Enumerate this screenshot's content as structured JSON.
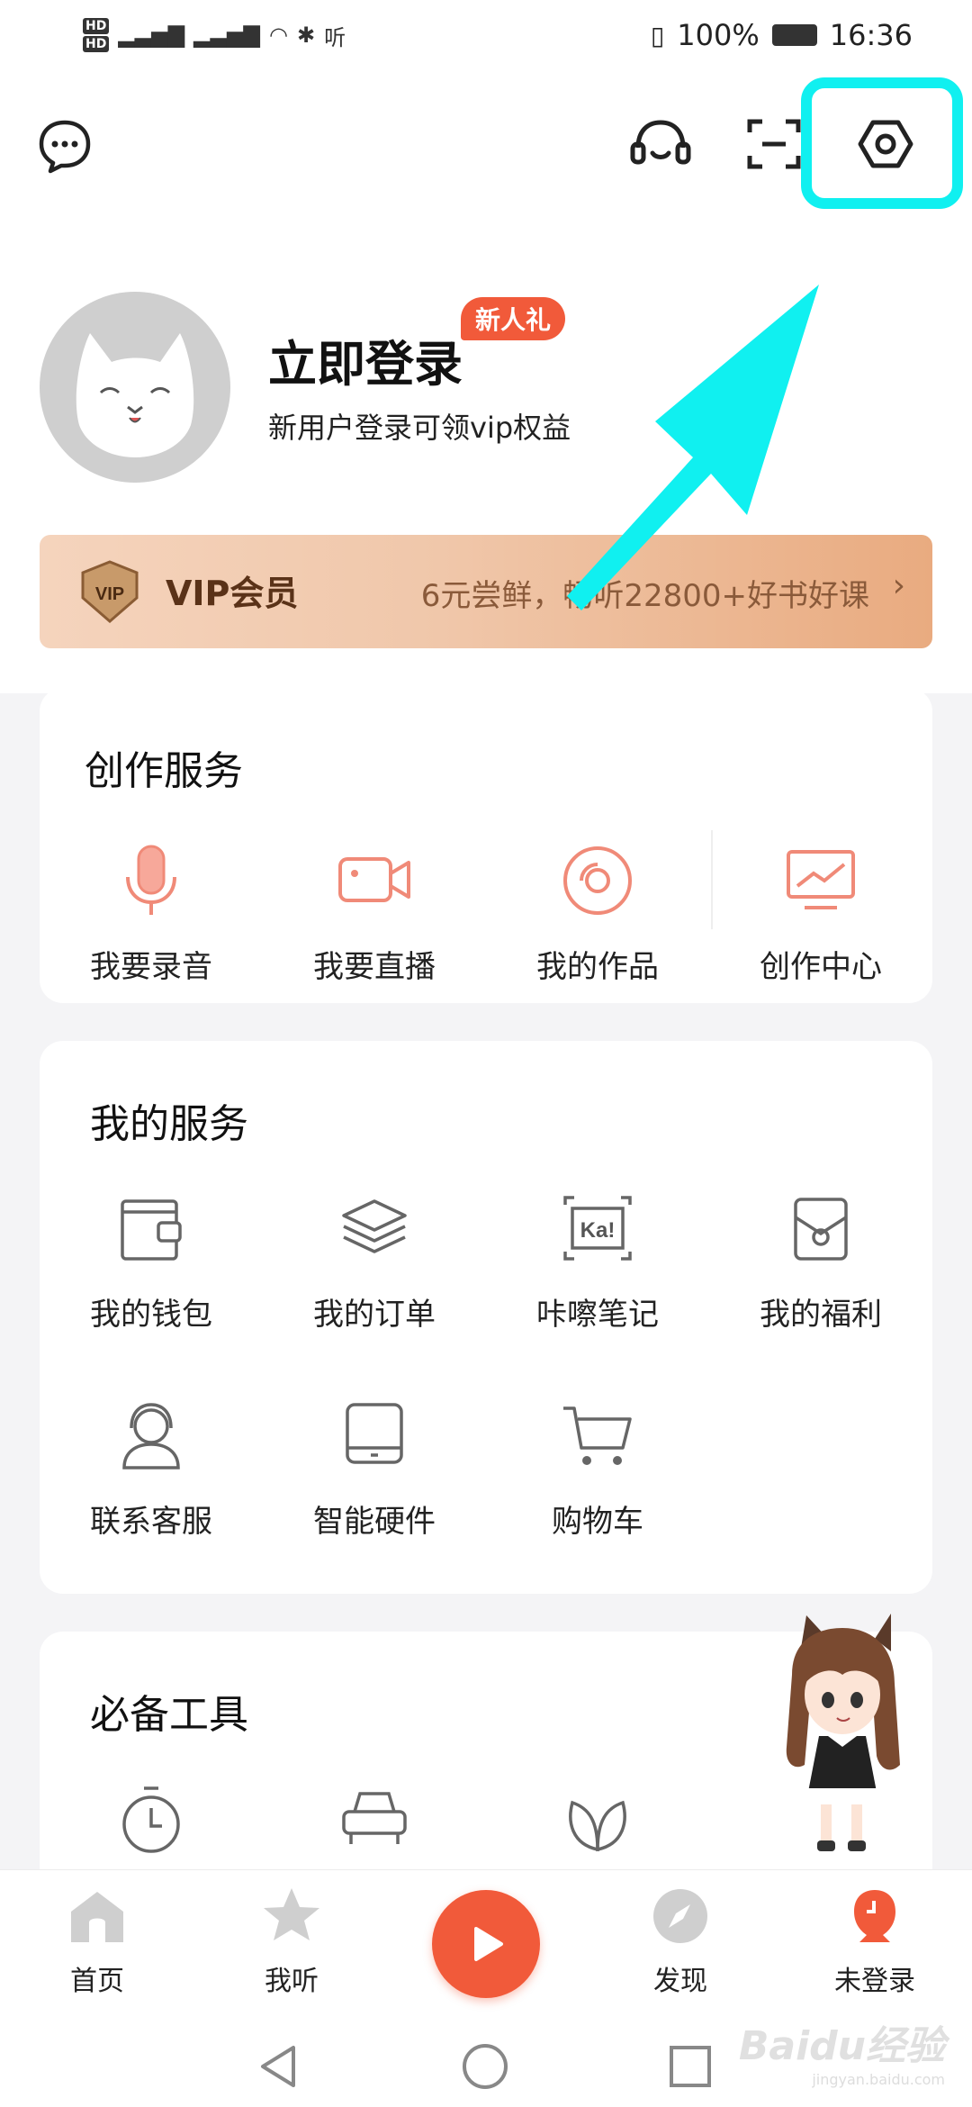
{
  "status_bar": {
    "left_text": "听",
    "battery": "100%",
    "time": "16:36"
  },
  "profile": {
    "title": "立即登录",
    "badge": "新人礼",
    "subtitle": "新用户登录可领vip权益"
  },
  "vip": {
    "badge_text": "VIP",
    "title": "VIP会员",
    "desc": "6元尝鲜，畅听22800+好书好课",
    "chevron": "›"
  },
  "creation": {
    "title": "创作服务",
    "items": [
      {
        "label": "我要录音",
        "icon": "microphone-icon"
      },
      {
        "label": "我要直播",
        "icon": "video-camera-icon"
      },
      {
        "label": "我的作品",
        "icon": "disc-icon"
      },
      {
        "label": "创作中心",
        "icon": "monitor-chart-icon"
      }
    ]
  },
  "services": {
    "title": "我的服务",
    "items": [
      {
        "label": "我的钱包",
        "icon": "wallet-icon"
      },
      {
        "label": "我的订单",
        "icon": "layers-icon"
      },
      {
        "label": "咔嚓笔记",
        "icon": "ka-note-icon",
        "icon_text": "Ka!"
      },
      {
        "label": "我的福利",
        "icon": "gift-box-icon"
      },
      {
        "label": "联系客服",
        "icon": "customer-service-icon"
      },
      {
        "label": "智能硬件",
        "icon": "device-icon"
      },
      {
        "label": "购物车",
        "icon": "cart-icon"
      }
    ]
  },
  "tools": {
    "title": "必备工具",
    "items": [
      {
        "icon": "timer-icon"
      },
      {
        "icon": "car-icon"
      },
      {
        "icon": "leaf-icon"
      }
    ]
  },
  "tabs": [
    {
      "label": "首页",
      "icon": "home-icon"
    },
    {
      "label": "我听",
      "icon": "star-icon"
    },
    {
      "label": "",
      "icon": "play-icon"
    },
    {
      "label": "发现",
      "icon": "compass-icon"
    },
    {
      "label": "未登录",
      "icon": "user-icon"
    }
  ],
  "watermark": {
    "text": "Baidu经验",
    "sub": "jingyan.baidu.com"
  },
  "colors": {
    "accent": "#f15a3a",
    "highlight": "#10f0f0",
    "icon_stroke": "#666666",
    "creation_icon": "#f08a78"
  }
}
